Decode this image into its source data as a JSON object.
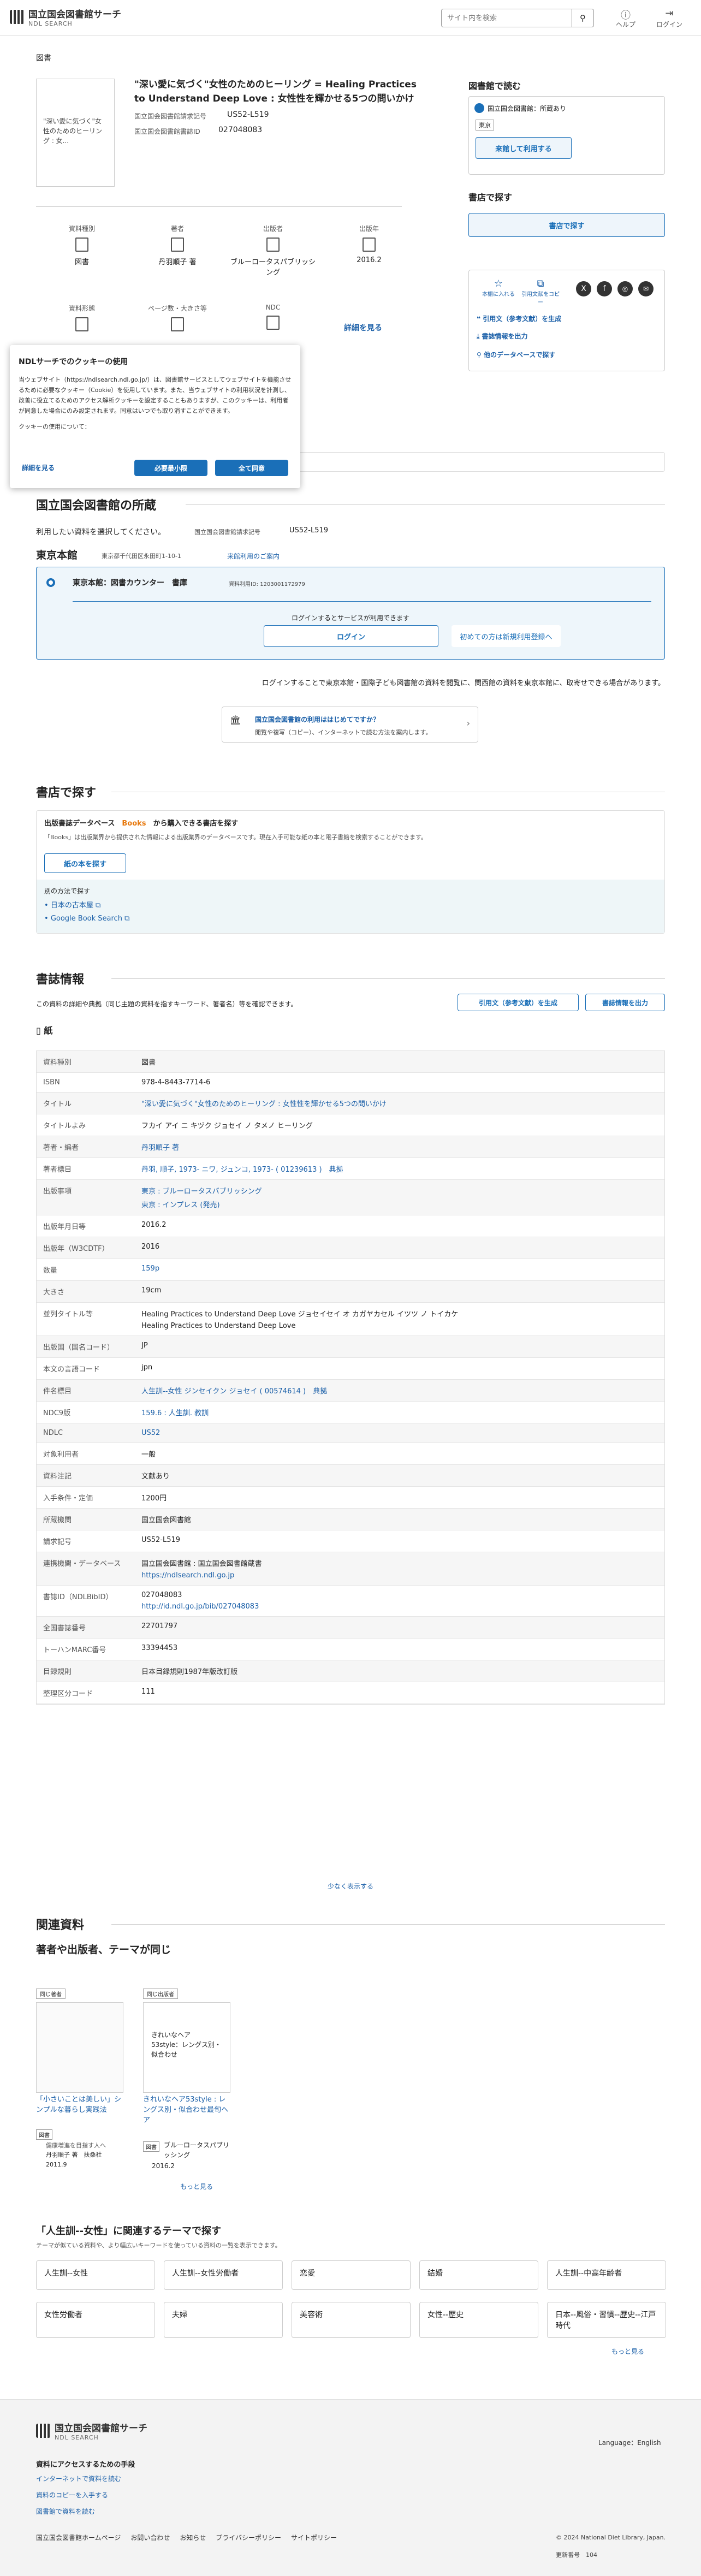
{
  "header": {
    "logo1": "国立国会図書館サーチ",
    "logo2": "NDL SEARCH",
    "search_placeholder": "サイト内を検索",
    "help": "ヘルプ",
    "login": "ログイン"
  },
  "breadcrumb": "図書",
  "book": {
    "thumb_text": "\"深い愛に気づく\"女性のためのヒーリング : 女...",
    "title": "\"深い愛に気づく\"女性のためのヒーリング = Healing Practices to Understand Deep Love : 女性性を輝かせる5つの問いかけ",
    "callno_label": "国立国会図書館請求記号",
    "callno": "US52-L519",
    "bibid_label": "国立国会図書館書誌ID",
    "bibid": "027048083"
  },
  "facets": [
    {
      "label": "資料種別",
      "value": "図書"
    },
    {
      "label": "著者",
      "value": "丹羽順子 著"
    },
    {
      "label": "出版者",
      "value": "ブルーロータスパブリッシング"
    },
    {
      "label": "出版年",
      "value": "2016.2"
    }
  ],
  "facets2": [
    {
      "label": "資料形態"
    },
    {
      "label": "ページ数・大きさ等"
    },
    {
      "label": "NDC"
    }
  ],
  "more_detail": "詳細を見る",
  "right": {
    "read_title": "図書館で読む",
    "ndl_label": "国立国会図書館：所蔵あり",
    "tag": "東京",
    "use_btn": "来館して利用する",
    "shop_title": "書店で探す",
    "shop_btn": "書店で探す",
    "icons": [
      "本棚に入れる",
      "引用文献をコピー"
    ],
    "cite": "引用文（参考文献）を生成",
    "export": "書誌情報を出力",
    "otherdb": "他のデータベースで探す"
  },
  "cookie": {
    "title": "NDLサーチでのクッキーの使用",
    "body": "当ウェブサイト（https://ndlsearch.ndl.go.jp/）は、図書館サービスとしてウェブサイトを機能させるために必要なクッキー（Cookie）を使用しています。また、当ウェブサイトの利用状況を計測し、改善に役立てるためのアクセス解析クッキーを設定することもありますが、このクッキーは、利用者が同意した場合にのみ設定されます。同意はいつでも取り消すことができます。",
    "usage": "クッキーの使用について：",
    "detail": "詳細を見る",
    "necessary": "必要最小限",
    "accept": "全て同意"
  },
  "holdings": {
    "title": "国立国会図書館の所蔵",
    "desc": "利用したい資料を選択してください。",
    "callno_label": "国立国会図書館請求記号",
    "callno": "US52-L519",
    "tokyo": "東京本館",
    "addr": "東京都千代田区永田町1-10-1",
    "guide": "来館利用のご案内",
    "counter": "東京本館：図書カウンター　書庫",
    "itemid": "資料利用ID: 1203001172979",
    "login_note": "ログインするとサービスが利用できます",
    "login_btn": "ログイン",
    "reg_btn": "初めての方は新規利用登録へ",
    "info": "ログインすることで東京本館・国際子ども図書館の資料を閲覧に、関西館の資料を東京本館に、取寄せできる場合があります。",
    "firsttime": "国立国会図書館の利用ははじめてですか？",
    "firsttime2": "閲覧や複写（コピー）、インターネットで読む方法を案内します。"
  },
  "shop": {
    "title": "書店で探す",
    "db": "出版書誌データベース",
    "books": "Books",
    "db2": "から購入できる書店を探す",
    "note": "「Books」は出版業界から提供された情報による出版業界のデータベースです。現在入手可能な紙の本と電子書籍を検索することができます。",
    "btn": "紙の本を探す",
    "other": "別の方法で探す",
    "l1": "日本の古本屋",
    "l2": "Google Book Search"
  },
  "bib": {
    "title": "書誌情報",
    "desc": "この資料の詳細や典拠（同じ主題の資料を指すキーワード、著者名）等を確認できます。",
    "cite": "引用文（参考文献）を生成",
    "export": "書誌情報を出力",
    "type": "紙",
    "less": "少なく表示する",
    "rows": [
      {
        "k": "資料種別",
        "v": [
          "図書"
        ]
      },
      {
        "k": "ISBN",
        "v": [
          "978-4-8443-7714-6"
        ]
      },
      {
        "k": "タイトル",
        "v": [
          "\"深い愛に気づく\"女性のためのヒーリング : 女性性を輝かせる5つの問いかけ"
        ]
      },
      {
        "k": "タイトルよみ",
        "v": [
          "フカイ アイ ニ キヅク ジョセイ ノ タメノ ヒーリング"
        ]
      },
      {
        "k": "著者・編者",
        "v": [
          "丹羽順子 著"
        ]
      },
      {
        "k": "著者標目",
        "v": [
          "丹羽, 順子, 1973- ニワ, ジュンコ, 1973- ( 01239613 )　典拠"
        ]
      },
      {
        "k": "出版事項",
        "v": [
          "東京 : ブルーロータスパブリッシング",
          "東京 : インプレス (発売)"
        ]
      },
      {
        "k": "出版年月日等",
        "v": [
          "2016.2"
        ]
      },
      {
        "k": "出版年（W3CDTF）",
        "v": [
          "2016"
        ]
      },
      {
        "k": "数量",
        "v": [
          "159p"
        ]
      },
      {
        "k": "大きさ",
        "v": [
          "19cm"
        ]
      },
      {
        "k": "並列タイトル等",
        "v": [
          "Healing Practices to Understand Deep Love ジョセイセイ オ カガヤカセル イツツ ノ トイカケ",
          "Healing Practices to Understand Deep Love"
        ]
      },
      {
        "k": "出版国（国名コード）",
        "v": [
          "JP"
        ]
      },
      {
        "k": "本文の言語コード",
        "v": [
          "jpn"
        ]
      },
      {
        "k": "件名標目",
        "v": [
          "人生訓--女性 ジンセイクン ジョセイ ( 00574614 )　典拠"
        ]
      },
      {
        "k": "NDC9版",
        "v": [
          "159.6 : 人生訓. 教訓"
        ]
      },
      {
        "k": "NDLC",
        "v": [
          "US52"
        ]
      },
      {
        "k": "対象利用者",
        "v": [
          "一般"
        ]
      },
      {
        "k": "資料注記",
        "v": [
          "文献あり"
        ]
      },
      {
        "k": "入手条件・定価",
        "v": [
          "1200円"
        ]
      },
      {
        "k": "所蔵機関",
        "v": [
          "国立国会図書館"
        ]
      },
      {
        "k": "請求記号",
        "v": [
          "US52-L519"
        ]
      },
      {
        "k": "連携機関・データベース",
        "v": [
          "国立国会図書館 : 国立国会図書館蔵書",
          "https://ndlsearch.ndl.go.jp"
        ]
      },
      {
        "k": "書誌ID（NDLBibID）",
        "v": [
          "027048083",
          "http://id.ndl.go.jp/bib/027048083"
        ]
      },
      {
        "k": "全国書誌番号",
        "v": [
          "22701797"
        ]
      },
      {
        "k": "トーハンMARC番号",
        "v": [
          "33394453"
        ]
      },
      {
        "k": "目録規則",
        "v": [
          "日本目録規則1987年版改訂版"
        ]
      },
      {
        "k": "整理区分コード",
        "v": [
          "111"
        ]
      }
    ]
  },
  "related": {
    "title": "関連資料",
    "sub": "著者や出版者、テーマが同じ",
    "more": "もっと見る",
    "items": [
      {
        "tag": "同じ著者",
        "title": "「小さいことは美しい」シンプルな暮らし実践法",
        "sub": "健康増進を目指す人へ",
        "author": "丹羽順子 著　扶桑社",
        "year": "2011.9",
        "kind": "図書"
      },
      {
        "tag": "同じ出版者",
        "cover": "きれいなヘア 53style：レングス別・似合わせ",
        "title": "きれいなヘア53style : レングス別・似合わせ最旬ヘア",
        "pub": "ブルーロータスパブリッシング",
        "year": "2016.2",
        "kind": "図書"
      }
    ]
  },
  "themes": {
    "title": "「人生訓--女性」に関連するテーマで探す",
    "desc": "テーマが似ている資料や、より幅広いキーワードを使っている資料の一覧を表示できます。",
    "items": [
      "人生訓--女性",
      "人生訓--女性労働者",
      "恋愛",
      "結婚",
      "人生訓--中高年齢者",
      "女性労働者",
      "夫婦",
      "美容術",
      "女性--歴史",
      "日本--風俗・習慣--歴史--江戸時代"
    ],
    "more": "もっと見る"
  },
  "footer": {
    "logo1": "国立国会図書館サーチ",
    "logo2": "NDL SEARCH",
    "lang": "Language：English",
    "t": "資料にアクセスするための手段",
    "l1": "インターネットで資料を読む",
    "l2": "資料のコピーを入手する",
    "l3": "図書館で資料を読む",
    "links": [
      "国立国会図書館ホームページ",
      "お問い合わせ",
      "お知らせ",
      "プライバシーポリシー",
      "サイトポリシー"
    ],
    "copy": "© 2024 National Diet Library, Japan.",
    "ver": "更新番号　104"
  }
}
